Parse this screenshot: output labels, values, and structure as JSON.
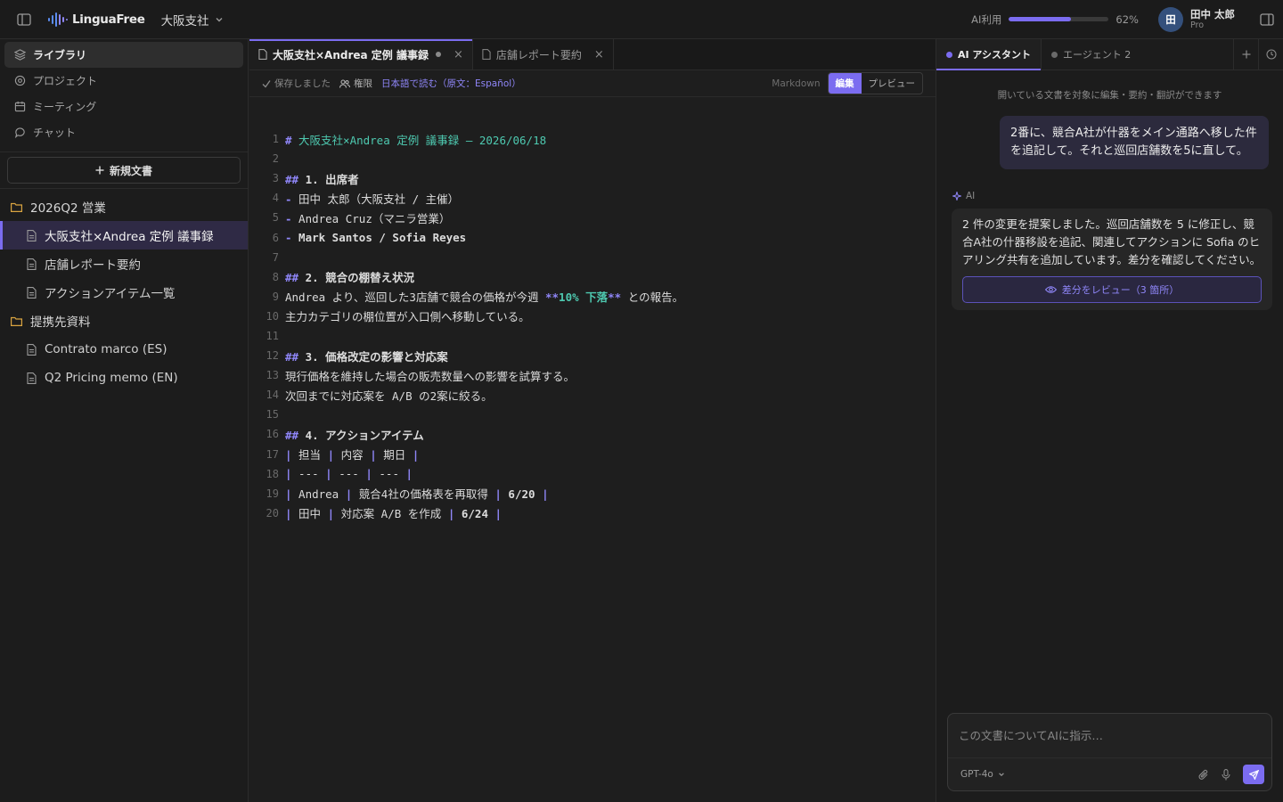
{
  "app": {
    "name": "LinguaFree",
    "workspace": "大阪支社",
    "usage_label": "AI利用",
    "usage_percent": 62,
    "usage_text": "62%",
    "accent": "#7b6cf0"
  },
  "user": {
    "initial": "田",
    "name": "田中 太郎",
    "plan": "Pro"
  },
  "sidebar": {
    "nav": [
      {
        "label": "ライブラリ",
        "icon": "layers-icon",
        "active": true
      },
      {
        "label": "プロジェクト",
        "icon": "project-icon"
      },
      {
        "label": "ミーティング",
        "icon": "calendar-icon"
      },
      {
        "label": "チャット",
        "icon": "chat-icon"
      }
    ],
    "new_doc": "新規文書",
    "folders": [
      {
        "name": "2026Q2 営業",
        "docs": [
          "大阪支社×Andrea 定例 議事録",
          "店舗レポート要約",
          "アクションアイテム一覧"
        ]
      },
      {
        "name": "提携先資料",
        "docs": [
          "Contrato marco (ES)",
          "Q2 Pricing memo (EN)"
        ]
      }
    ]
  },
  "editor": {
    "tabs": [
      {
        "label": "大阪支社×Andrea 定例 議事録",
        "active": true,
        "modified": true
      },
      {
        "label": "店舗レポート要約"
      }
    ],
    "toolbar": {
      "saved": "保存しました",
      "permission": "権限",
      "translate": "日本語で読む（原文：Español）",
      "mode_label": "Markdown",
      "edit": "編集",
      "preview": "プレビュー"
    },
    "line_numbers": [
      "1",
      "2",
      "3",
      "4",
      "5",
      "6",
      "7",
      "8",
      "9",
      "10",
      "11",
      "12",
      "13",
      "14",
      "15",
      "16",
      "17",
      "18",
      "19",
      "20"
    ],
    "lines": [
      "# 大阪支社×Andrea 定例 議事録 — 2026/06/18",
      "",
      "## 1. 出席者",
      "- 田中 太郎（大阪支社 / 主催）",
      "- Andrea Cruz（マニラ営業）",
      "- Mark Santos / Sofia Reyes",
      "",
      "## 2. 競合の棚替え状況",
      "Andrea より、巡回した3店舗で競合の価格が今週 **10% 下落** との報告。",
      "主力カテゴリの棚位置が入口側へ移動している。",
      "",
      "## 3. 価格改定の影響と対応案",
      "現行価格を維持した場合の販売数量への影響を試算する。",
      "次回までに対応案を A/B の2案に絞る。",
      "",
      "## 4. アクションアイテム",
      "| 担当 | 内容 | 期日 |",
      "| --- | --- | --- |",
      "| Andrea | 競合4社の価格表を再取得 | 6/20 |",
      "| 田中 | 対応案 A/B を作成 | 6/24 |"
    ]
  },
  "ai_panel": {
    "tabs": [
      {
        "label": "AI アシスタント",
        "active": true,
        "dot_color": "#7b6cf0"
      },
      {
        "label": "エージェント 2",
        "dot_color": "#6a6a6a"
      }
    ],
    "hint": "開いている文書を対象に編集・要約・翻訳ができます",
    "user_message": "2番に、競合A社が什器をメイン通路へ移した件を追記して。それと巡回店舗数を5に直して。",
    "ai_label": "AI",
    "ai_message": "2 件の変更を提案しました。巡回店舗数を 5 に修正し、競合A社の什器移設を追記、関連してアクションに Sofia のヒアリング共有を追加しています。差分を確認してください。",
    "diff_button": "差分をレビュー（3 箇所）",
    "input_placeholder": "この文書についてAIに指示…",
    "model": "GPT-4o"
  }
}
